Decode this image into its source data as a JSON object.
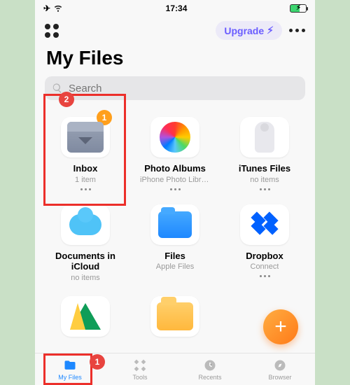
{
  "status": {
    "time": "17:34"
  },
  "header": {
    "upgrade": "Upgrade",
    "title": "My Files"
  },
  "search": {
    "placeholder": "Search"
  },
  "annotations": {
    "badge_search": "2",
    "badge_inbox": "1",
    "badge_tab": "1"
  },
  "items": [
    {
      "label": "Inbox",
      "sub": "1 item",
      "icon": "inbox"
    },
    {
      "label": "Photo Albums",
      "sub": "iPhone Photo Libra...",
      "icon": "photos"
    },
    {
      "label": "iTunes Files",
      "sub": "no items",
      "icon": "itunes"
    },
    {
      "label": "Documents in iCloud",
      "sub": "no items",
      "icon": "cloud"
    },
    {
      "label": "Files",
      "sub": "Apple Files",
      "icon": "files"
    },
    {
      "label": "Dropbox",
      "sub": "Connect",
      "icon": "dropbox"
    },
    {
      "label": "",
      "sub": "",
      "icon": "drive"
    },
    {
      "label": "",
      "sub": "",
      "icon": "gfolder"
    }
  ],
  "tabs": [
    {
      "label": "My Files"
    },
    {
      "label": "Tools"
    },
    {
      "label": "Recents"
    },
    {
      "label": "Browser"
    }
  ]
}
